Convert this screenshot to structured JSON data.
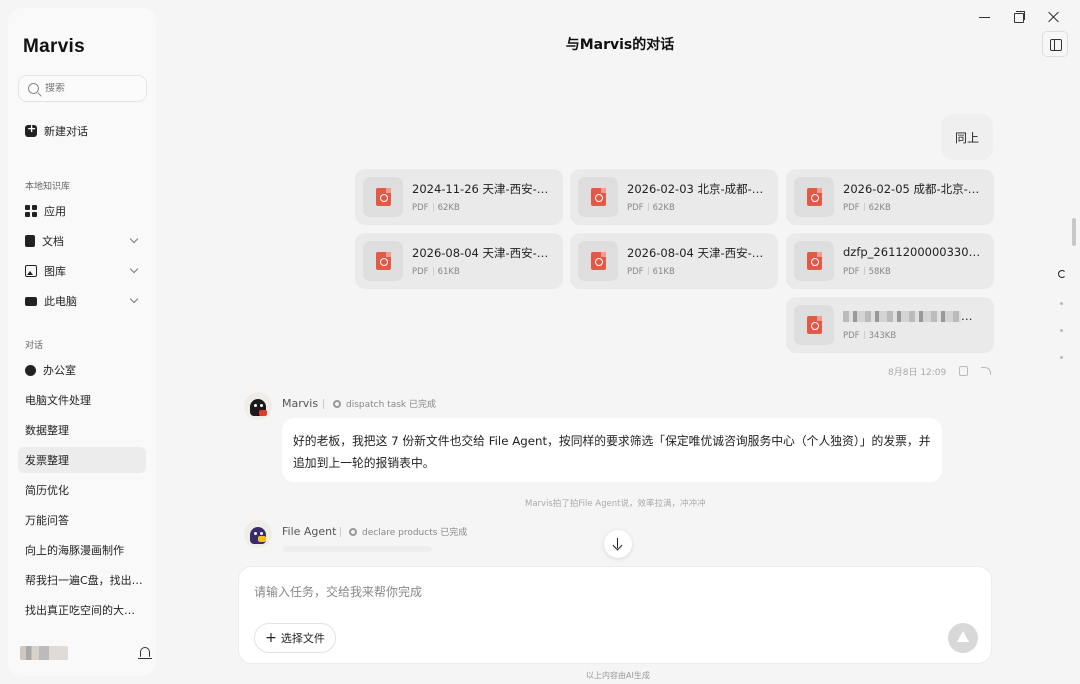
{
  "app": {
    "name": "Marvis",
    "title": "与Marvis的对话"
  },
  "search": {
    "placeholder": "搜索"
  },
  "sidebar": {
    "new_chat": "新建对话",
    "kb_title": "本地知识库",
    "kb_items": [
      {
        "label": "应用",
        "icon": "apps-icon",
        "expandable": false
      },
      {
        "label": "文档",
        "icon": "document-icon",
        "expandable": true
      },
      {
        "label": "图库",
        "icon": "image-icon",
        "expandable": true
      },
      {
        "label": "此电脑",
        "icon": "computer-icon",
        "expandable": true
      }
    ],
    "conv_title": "对话",
    "conversations": [
      {
        "label": "办公室",
        "icon": "office-icon"
      },
      {
        "label": "电脑文件处理"
      },
      {
        "label": "数据整理"
      },
      {
        "label": "发票整理",
        "active": true
      },
      {
        "label": "简历优化"
      },
      {
        "label": "万能问答"
      },
      {
        "label": "向上的海豚漫画制作"
      },
      {
        "label": "帮我扫一遍C盘，找出…"
      },
      {
        "label": "找出真正吃空间的大…"
      }
    ]
  },
  "user_message": {
    "text": "同上",
    "files": [
      {
        "name": "2024-11-26 天津-西安-2…",
        "type": "PDF",
        "size": "62KB"
      },
      {
        "name": "2026-02-03 北京-成都-2…",
        "type": "PDF",
        "size": "62KB"
      },
      {
        "name": "2026-02-05 成都-北京-2…",
        "type": "PDF",
        "size": "62KB"
      },
      {
        "name": "2026-08-04 天津-西安-2…",
        "type": "PDF",
        "size": "61KB"
      },
      {
        "name": "2026-08-04 天津-西安-2…",
        "type": "PDF",
        "size": "61KB"
      },
      {
        "name": "dzfp_26112000003306…",
        "type": "PDF",
        "size": "58KB"
      },
      {
        "name": "",
        "type": "PDF",
        "size": "343KB",
        "blurred": true
      }
    ],
    "time": "8月8日 12:09"
  },
  "assistant": {
    "sender": "Marvis",
    "task": "dispatch task 已完成",
    "text": "好的老板，我把这 7 份新文件也交给 File Agent，按同样的要求筛选「保定唯优诚咨询服务中心（个人独资）」的发票，并追加到上一轮的报销表中。",
    "note": "Marvis拍了拍File Agent说，效率拉满，冲冲冲"
  },
  "agent": {
    "sender": "File Agent",
    "task": "declare products 已完成"
  },
  "composer": {
    "placeholder": "请输入任务，交给我来帮你完成",
    "pick_files": "选择文件",
    "footer": "以上内容由AI生成"
  }
}
